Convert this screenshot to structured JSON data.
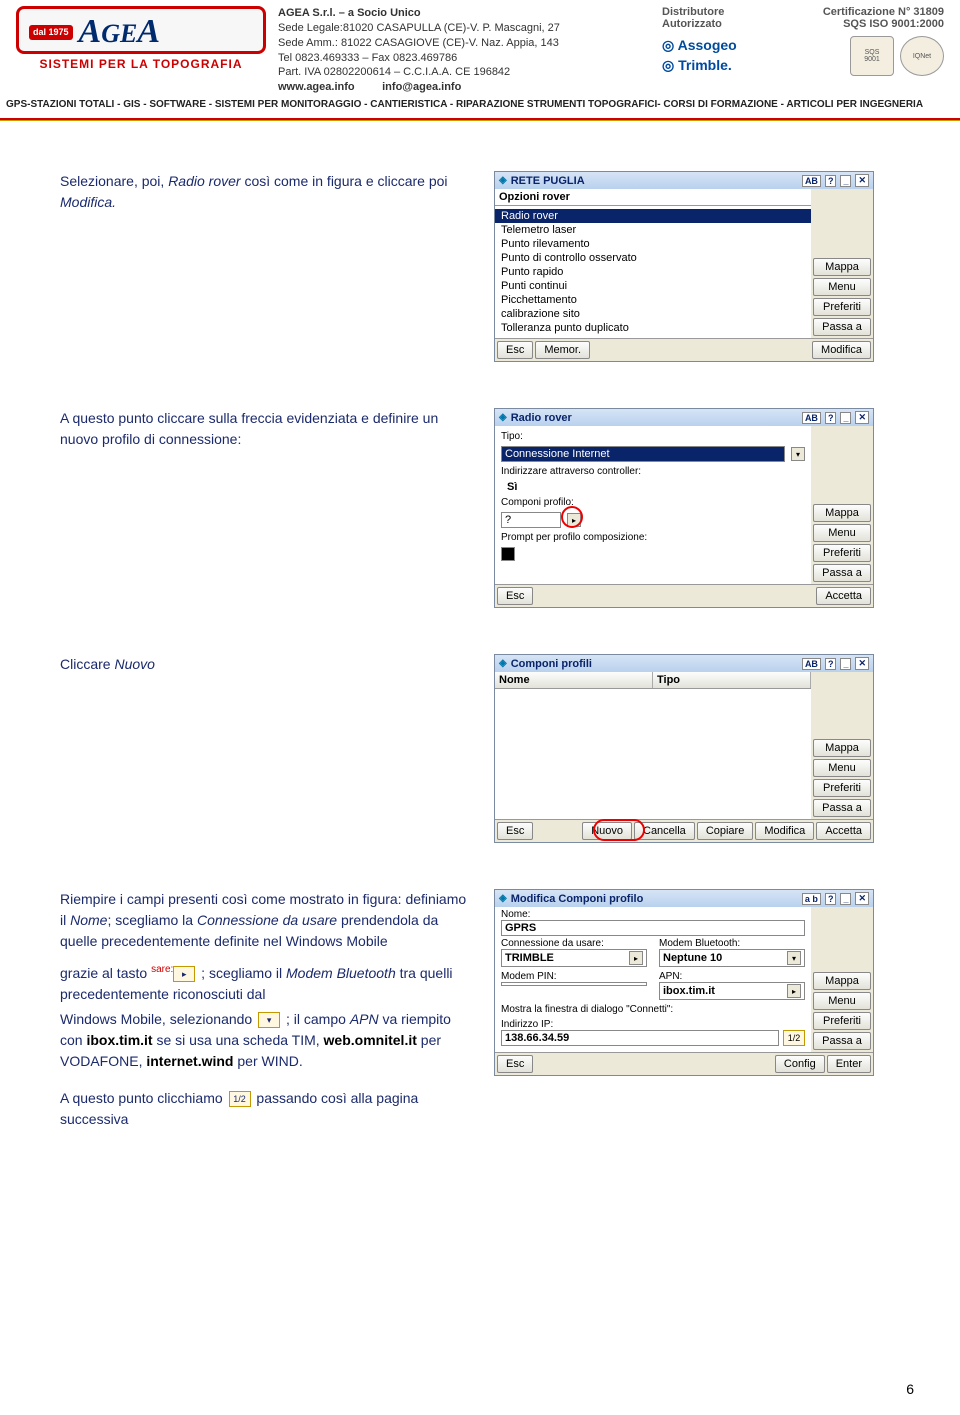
{
  "page_number": "6",
  "header": {
    "company_name": "AGEA S.r.l. – a Socio Unico",
    "sede_legale": "Sede Legale:81020 CASAPULLA (CE)-V. P. Mascagni, 27",
    "sede_amm": "Sede Amm.: 81022 CASAGIOVE (CE)-V. Naz. Appia, 143",
    "tel": "Tel 0823.469333 – Fax 0823.469786",
    "piva": "Part. IVA 02802200614 – C.C.I.A.A. CE 196842",
    "web": "www.agea.info",
    "email": "info@agea.info",
    "logo_sub": "SISTEMI PER LA TOPOGRAFIA",
    "badge_text": "dal 1975",
    "distributore": "Distributore",
    "autorizzato": "Autorizzato",
    "brand1": "Assogeo",
    "brand2": "Trimble",
    "cert1": "Certificazione N° 31809",
    "cert2": "SQS ISO 9001:2000",
    "tagline": "GPS-STAZIONI TOTALI - GIS - SOFTWARE - SISTEMI PER MONITORAGGIO - CANTIERISTICA - RIPARAZIONE STRUMENTI TOPOGRAFICI- CORSI DI FORMAZIONE - ARTICOLI PER INGEGNERIA"
  },
  "body": {
    "p1_a": "Selezionare, poi, ",
    "p1_i": "Radio rover",
    "p1_b": " così come in figura e cliccare poi ",
    "p1_i2": "Modifica.",
    "p2": "A questo punto cliccare sulla freccia evidenziata e definire un nuovo profilo di connessione:",
    "p3_a": "Cliccare ",
    "p3_i": "Nuovo",
    "p4_a": "Riempire i campi presenti così come mostrato in figura: definiamo il ",
    "p4_i1": "Nome",
    "p4_b": "; scegliamo la ",
    "p4_i2": "Connessione da usare",
    "p4_c": " prendendola da quelle precedentemente definite nel Windows Mobile",
    "p5_a": "grazie al tasto ",
    "p5_b": " ; scegliamo il ",
    "p5_i1": "Modem Bluetooth",
    "p5_c": " tra quelli precedentemente riconosciuti dal",
    "p6_a": "Windows Mobile, selezionando ",
    "p6_b": " ; il campo ",
    "p6_i1": "APN",
    "p6_c": " va riempito con ",
    "p6_bold1": "ibox.tim.it",
    "p6_d": " se si usa una scheda TIM, ",
    "p6_bold2": "web.omnitel.it",
    "p6_e": " per VODAFONE, ",
    "p6_bold3": "internet.wind",
    "p6_f": " per WIND.",
    "p7_a": "A questo punto clicchiamo ",
    "p7_b": " passando così alla pagina successiva"
  },
  "screenshots": {
    "s1": {
      "title": "RETE PUGLIA",
      "section": "Opzioni rover",
      "items": [
        "Radio rover",
        "Telemetro laser",
        "Punto rilevamento",
        "Punto di controllo osservato",
        "Punto rapido",
        "Punti continui",
        "Picchettamento",
        "calibrazione sito",
        "Tolleranza punto duplicato"
      ],
      "side": [
        "Mappa",
        "Menu",
        "Preferiti",
        "Passa a"
      ],
      "bottom": {
        "esc": "Esc",
        "memor": "Memor.",
        "modifica": "Modifica"
      }
    },
    "s2": {
      "title": "Radio rover",
      "tipo_label": "Tipo:",
      "tipo_val": "Connessione Internet",
      "indir_label": "Indirizzare attraverso controller:",
      "indir_val": "Sì",
      "comp_label": "Componi profilo:",
      "comp_val": "?",
      "prompt_label": "Prompt per profilo composizione:",
      "side": [
        "Mappa",
        "Menu",
        "Preferiti",
        "Passa a"
      ],
      "bottom": {
        "esc": "Esc",
        "accetta": "Accetta"
      }
    },
    "s3": {
      "title": "Componi profili",
      "col1": "Nome",
      "col2": "Tipo",
      "side": [
        "Mappa",
        "Menu",
        "Preferiti",
        "Passa a"
      ],
      "bottom": {
        "esc": "Esc",
        "nuovo": "Nuovo",
        "cancella": "Cancella",
        "copiare": "Copiare",
        "modifica": "Modifica",
        "accetta": "Accetta"
      }
    },
    "s4": {
      "title": "Modifica Componi profilo",
      "nome_label": "Nome:",
      "nome_val": "GPRS",
      "conn_label": "Connessione da usare:",
      "conn_val": "TRIMBLE",
      "modem_label": "Modem Bluetooth:",
      "modem_val": "Neptune 10",
      "pin_label": "Modem PIN:",
      "pin_val": "",
      "apn_label": "APN:",
      "apn_val": "ibox.tim.it",
      "connetti_label": "Mostra la finestra di dialogo \"Connetti\":",
      "ip_label": "Indirizzo IP:",
      "ip_val": "138.66.34.59",
      "pager": "1/2",
      "side": [
        "Mappa",
        "Menu",
        "Preferiti",
        "Passa a"
      ],
      "bottom": {
        "esc": "Esc",
        "config": "Config",
        "enter": "Enter"
      }
    }
  },
  "icons": {
    "sare": "sare:",
    "half": "1/2",
    "ab": "AB",
    "q": "?",
    "dash": "_",
    "x": "✕"
  }
}
